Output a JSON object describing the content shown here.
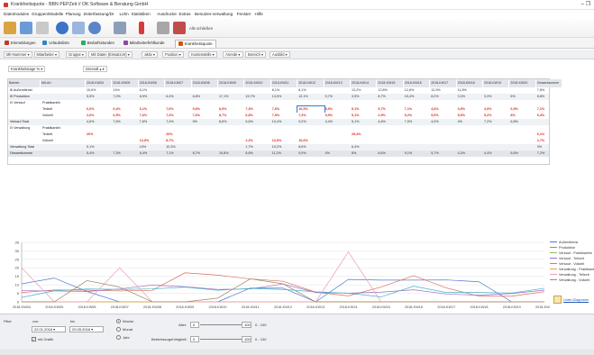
{
  "window": {
    "title": "Krankheitsquote - BBN PEPZeit // OK Software & Beratung GmbH",
    "controls": "– ❐"
  },
  "menu": [
    "Dateimodulen",
    "Gruppen/Modelle",
    "Planung",
    "Zeiterfassung/DI",
    "Lohn",
    "Statistiken",
    "Ausdrucke",
    "Extras",
    "Benutzer-verwaltung",
    "Fenster",
    "Hilfe"
  ],
  "toolbar": {
    "close_all": "Alle schließen"
  },
  "tabs": [
    {
      "label": "Einmeldungen",
      "color": "#c0392b"
    },
    {
      "label": "Urlaubsliste",
      "color": "#2e86c1"
    },
    {
      "label": "Bedarfsstunden",
      "color": "#27ae60"
    },
    {
      "label": "Mitarbeiterfehlkunde",
      "color": "#8e44ad"
    },
    {
      "label": "Krankheitsquote",
      "color": "#d35400"
    }
  ],
  "group_chips": [
    "Mit-Nummer",
    "Mitarbeiter",
    "Gruppe",
    "Mit Daten (Einsatzort)",
    "aktiv",
    "Position",
    "Kostenstelle",
    "Anrede",
    "Bereich",
    "Ausbild"
  ],
  "filter_row": {
    "measure_chip": "Krankheitstage %",
    "interval_chip": "Intervall"
  },
  "grid": {
    "dim_headers": [
      "Betrieb",
      "Mit-Art"
    ],
    "columns": [
      "2018-KW04",
      "2018-KW05",
      "2018-KW06",
      "2018-KW07",
      "2018-KW08",
      "2018-KW09",
      "2018-KW10",
      "2018-KW11",
      "2018-KW12",
      "2018-KW13",
      "2018-KW14",
      "2018-KW15",
      "2018-KW16",
      "2018-KW17",
      "2018-KW18",
      "2018-KW19",
      "2018-KW20",
      "Gesamtsumme"
    ],
    "rows": [
      {
        "l1": "⊞ Außendienst",
        "l2": "",
        "bg": "#ffffff",
        "red": false,
        "cells": [
          "10,6%",
          "14%",
          "6,1%",
          "",
          "",
          "",
          "",
          "8,1%",
          "8,1%",
          "",
          "13,2%",
          "12,8%",
          "12,8%",
          "12,9%",
          "11,8%",
          "",
          "",
          "7,8%"
        ]
      },
      {
        "l1": "⊞ Produktion",
        "l2": "",
        "bg": "#eef1f5",
        "red": false,
        "cells": [
          "5,5%",
          "7,0%",
          "6,9%",
          "6,4%",
          "6,8%",
          "17,1%",
          "15,7%",
          "13,5%",
          "12,1%",
          "5,7%",
          "3,5%",
          "8,7%",
          "15,4%",
          "8,2%",
          "3,3%",
          "3,3%",
          "6%",
          "8,8%"
        ]
      },
      {
        "l1": "⊟ Verkauf",
        "l2": "Praktikant/in",
        "bg": "#ffffff",
        "red": false,
        "cells": [
          "",
          "",
          "",
          "",
          "",
          "",
          "",
          "",
          "",
          "",
          "",
          "",
          "",
          "",
          "",
          "",
          "",
          ""
        ]
      },
      {
        "l1": "",
        "l2": "Teilzeit",
        "bg": "#ffffff",
        "red": true,
        "cells": [
          "6,6%",
          "6,4%",
          "6,1%",
          "7,6%",
          "9,9%",
          "8,9%",
          "7,3%",
          "7,6%",
          "10,5%",
          "5,5%",
          "5,1%",
          "5,7%",
          "7,1%",
          "4,6%",
          "3,9%",
          "4,9%",
          "6,9%",
          "7,1%"
        ]
      },
      {
        "l1": "",
        "l2": "Vollzeit",
        "bg": "#ffffff",
        "red": true,
        "cells": [
          "2,6%",
          "6,5%",
          "7,6%",
          "7,3%",
          "7,6%",
          "8,7%",
          "6,8%",
          "7,9%",
          "7,3%",
          "5,9%",
          "5,1%",
          "2,9%",
          "9,2%",
          "5,5%",
          "5,5%",
          "5,2%",
          "8%",
          "6,4%"
        ]
      },
      {
        "l1": "Verkauf Total",
        "l2": "",
        "bg": "#eef1f5",
        "red": false,
        "cells": [
          "4,6%",
          "7,6%",
          "7,6%",
          "7,4%",
          "9%",
          "8,6%",
          "6,6%",
          "10,4%",
          "9,2%",
          "4,4%",
          "5,1%",
          "4,6%",
          "7,0%",
          "4,0%",
          "4%",
          "7,2%",
          "6,8%",
          ""
        ]
      },
      {
        "l1": "⊟ Verwaltung",
        "l2": "Praktikant/in",
        "bg": "#ffffff",
        "red": false,
        "cells": [
          "",
          "",
          "",
          "",
          "",
          "",
          "",
          "",
          "",
          "",
          "",
          "",
          "",
          "",
          "",
          "",
          "",
          ""
        ]
      },
      {
        "l1": "",
        "l2": "Teilzeit",
        "bg": "#ffffff",
        "red": true,
        "cells": [
          "20%",
          "",
          "",
          "20%",
          "",
          "",
          "",
          "",
          "",
          "",
          "29,4%",
          "",
          "",
          "",
          "",
          "",
          "",
          "6,1%"
        ]
      },
      {
        "l1": "",
        "l2": "Vollzeit",
        "bg": "#ffffff",
        "red": true,
        "cells": [
          "",
          "",
          "12,5%",
          "8,7%",
          "",
          "",
          "2,2%",
          "13,5%",
          "10,6%",
          "",
          "",
          "",
          "",
          "",
          "",
          "",
          "",
          "2,7%"
        ]
      },
      {
        "l1": "Verwaltung Total",
        "l2": "",
        "bg": "#eef1f5",
        "red": false,
        "cells": [
          "5,1%",
          "",
          "10%",
          "10,3%",
          "",
          "",
          "1,7%",
          "10,2%",
          "8,6%",
          "",
          "6,4%",
          "",
          "",
          "",
          "",
          "",
          "",
          "3%"
        ]
      },
      {
        "l1": "Gesamtsumme",
        "l2": "",
        "bg": "#e2e5ea",
        "red": false,
        "cells": [
          "5,4%",
          "7,3%",
          "6,4%",
          "7,1%",
          "8,7%",
          "10,8%",
          "8,8%",
          "11,2%",
          "9,9%",
          "4%",
          "8%",
          "8,6%",
          "9,1%",
          "5,7%",
          "4,3%",
          "4,4%",
          "6,6%",
          "7,2%"
        ]
      }
    ]
  },
  "chart_data": {
    "type": "line",
    "categories": [
      "2018-KW04",
      "2018-KW05",
      "2018-KW06",
      "2018-KW07",
      "2018-KW08",
      "2018-KW09",
      "2018-KW10",
      "2018-KW11",
      "2018-KW12",
      "2018-KW13",
      "2018-KW14",
      "2018-KW15",
      "2018-KW16",
      "2018-KW17",
      "2018-KW18",
      "2018-KW19",
      "2018-KW20"
    ],
    "yticks": [
      "0",
      "5",
      "10",
      "15",
      "20",
      "25",
      "30",
      "35"
    ],
    "ylim": [
      0,
      35
    ],
    "grid": true,
    "legend_position": "right",
    "series": [
      {
        "name": "Außendienst",
        "color": "#4f7bd0",
        "values": [
          10.6,
          14,
          6.1,
          0,
          0,
          0,
          0,
          8.1,
          8.1,
          0,
          13.2,
          12.8,
          12.8,
          12.9,
          11.8,
          0,
          0
        ]
      },
      {
        "name": "Produktion",
        "color": "#e06a5a",
        "values": [
          5.5,
          7,
          6.9,
          6.4,
          6.8,
          17.1,
          15.7,
          13.5,
          12.1,
          5.7,
          3.5,
          8.7,
          15.4,
          8.2,
          3.3,
          3.3,
          6
        ]
      },
      {
        "name": "Verkauf - Praktikant/in",
        "color": "#8bbf5a",
        "values": [
          0,
          0,
          0,
          0,
          0,
          0,
          0,
          0,
          0,
          0,
          0,
          0,
          0,
          0,
          0,
          0,
          0
        ]
      },
      {
        "name": "Verkauf - Teilzeit",
        "color": "#9a6fc4",
        "values": [
          6.6,
          6.4,
          6.1,
          7.6,
          9.9,
          8.9,
          7.3,
          7.6,
          10.5,
          5.5,
          5.1,
          5.7,
          7.1,
          4.6,
          3.9,
          4.9,
          6.9
        ]
      },
      {
        "name": "Verkauf - Vollzeit",
        "color": "#46b1c9",
        "values": [
          2.6,
          6.5,
          7.6,
          7.3,
          7.6,
          8.7,
          6.8,
          7.9,
          7.3,
          5.9,
          5.1,
          2.9,
          9.2,
          5.5,
          5.5,
          5.2,
          8
        ]
      },
      {
        "name": "Verwaltung - Praktikant/in",
        "color": "#f0a04b",
        "values": [
          0,
          0,
          0,
          0,
          0,
          0,
          0,
          0,
          0,
          0,
          0,
          0,
          0,
          0,
          0,
          0,
          0
        ]
      },
      {
        "name": "Verwaltung - Teilzeit",
        "color": "#e8a0b8",
        "values": [
          20,
          0,
          0,
          20,
          0,
          0,
          0,
          0,
          0,
          0,
          29.4,
          0,
          0,
          0,
          0,
          0,
          0
        ]
      },
      {
        "name": "Verwaltung - Vollzeit",
        "color": "#a08a6a",
        "values": [
          0,
          0,
          12.5,
          8.7,
          0,
          0,
          2.2,
          13.5,
          10.6,
          0,
          0,
          0,
          0,
          0,
          0,
          0,
          0
        ]
      }
    ]
  },
  "chart_link": "Unter-Diagramm",
  "bottom": {
    "filter_label": "Filter",
    "from_label": "von:",
    "to_label": "bis:",
    "from_value": "22.01.2018",
    "to_value": "20.05.2018",
    "with_chart": "mit Grafik",
    "period_options": [
      "Woche",
      "Monat",
      "Jahr"
    ],
    "age_label": "Alter:",
    "age_from": "0",
    "age_to": "100",
    "age_range": "0 - 100",
    "tenure_label": "Betriebszugehörigkeit:",
    "tenure_from": "0",
    "tenure_to": "100",
    "tenure_range": "0 - 100"
  }
}
